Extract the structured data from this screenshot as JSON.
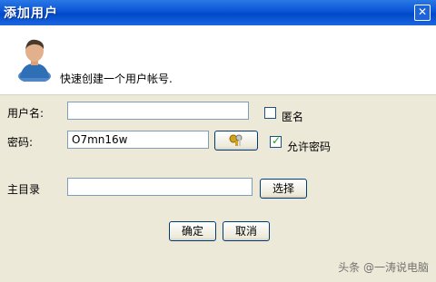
{
  "window": {
    "title": "添加用户",
    "close_icon": "close-icon"
  },
  "header": {
    "description": "快速创建一个用户帐号."
  },
  "form": {
    "username": {
      "label": "用户名:",
      "value": ""
    },
    "anonymous": {
      "label": "匿名",
      "checked": false
    },
    "password": {
      "label": "密码:",
      "value": "O7mn16w"
    },
    "allow_password": {
      "label": "允许密码",
      "checked": true
    },
    "home_dir": {
      "label": "主目录",
      "value": "",
      "browse_label": "选择"
    }
  },
  "buttons": {
    "ok": "确定",
    "cancel": "取消"
  },
  "watermark": "头条 @一涛说电脑"
}
